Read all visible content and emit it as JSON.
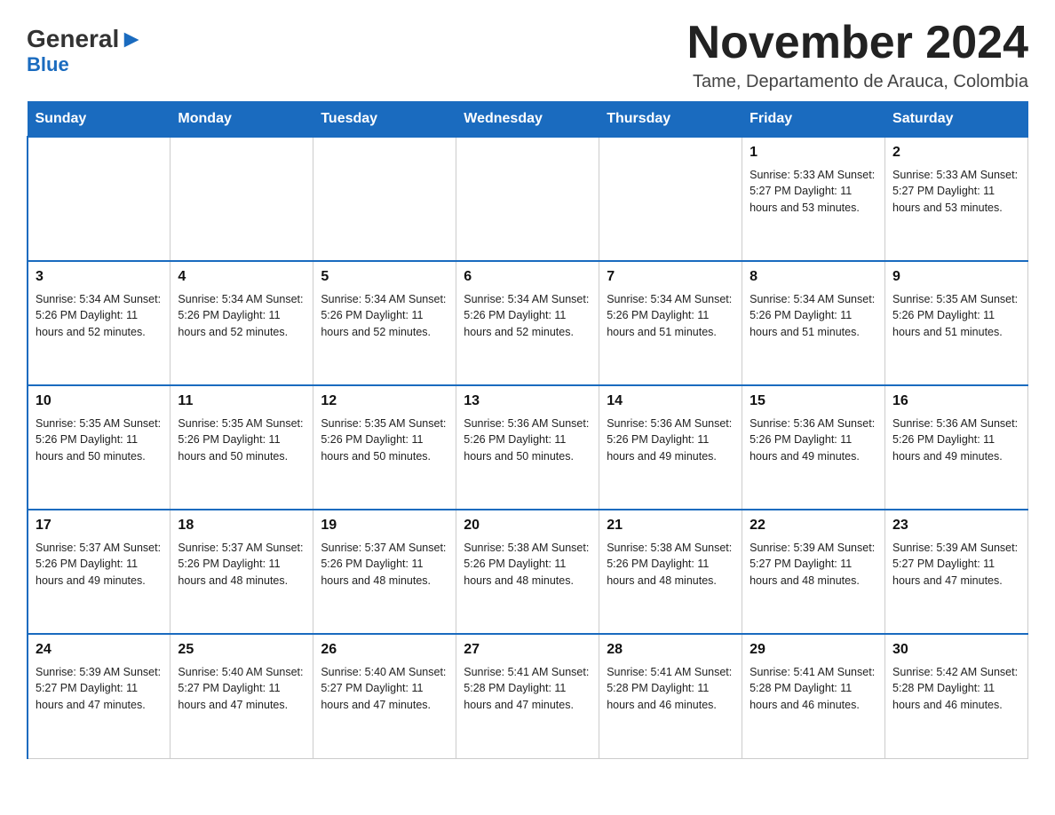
{
  "header": {
    "logo": {
      "general": "General",
      "blue": "Blue",
      "arrow": "▶"
    },
    "title": "November 2024",
    "subtitle": "Tame, Departamento de Arauca, Colombia"
  },
  "days_of_week": [
    "Sunday",
    "Monday",
    "Tuesday",
    "Wednesday",
    "Thursday",
    "Friday",
    "Saturday"
  ],
  "weeks": [
    [
      {
        "day": "",
        "info": ""
      },
      {
        "day": "",
        "info": ""
      },
      {
        "day": "",
        "info": ""
      },
      {
        "day": "",
        "info": ""
      },
      {
        "day": "",
        "info": ""
      },
      {
        "day": "1",
        "info": "Sunrise: 5:33 AM\nSunset: 5:27 PM\nDaylight: 11 hours and 53 minutes."
      },
      {
        "day": "2",
        "info": "Sunrise: 5:33 AM\nSunset: 5:27 PM\nDaylight: 11 hours and 53 minutes."
      }
    ],
    [
      {
        "day": "3",
        "info": "Sunrise: 5:34 AM\nSunset: 5:26 PM\nDaylight: 11 hours and 52 minutes."
      },
      {
        "day": "4",
        "info": "Sunrise: 5:34 AM\nSunset: 5:26 PM\nDaylight: 11 hours and 52 minutes."
      },
      {
        "day": "5",
        "info": "Sunrise: 5:34 AM\nSunset: 5:26 PM\nDaylight: 11 hours and 52 minutes."
      },
      {
        "day": "6",
        "info": "Sunrise: 5:34 AM\nSunset: 5:26 PM\nDaylight: 11 hours and 52 minutes."
      },
      {
        "day": "7",
        "info": "Sunrise: 5:34 AM\nSunset: 5:26 PM\nDaylight: 11 hours and 51 minutes."
      },
      {
        "day": "8",
        "info": "Sunrise: 5:34 AM\nSunset: 5:26 PM\nDaylight: 11 hours and 51 minutes."
      },
      {
        "day": "9",
        "info": "Sunrise: 5:35 AM\nSunset: 5:26 PM\nDaylight: 11 hours and 51 minutes."
      }
    ],
    [
      {
        "day": "10",
        "info": "Sunrise: 5:35 AM\nSunset: 5:26 PM\nDaylight: 11 hours and 50 minutes."
      },
      {
        "day": "11",
        "info": "Sunrise: 5:35 AM\nSunset: 5:26 PM\nDaylight: 11 hours and 50 minutes."
      },
      {
        "day": "12",
        "info": "Sunrise: 5:35 AM\nSunset: 5:26 PM\nDaylight: 11 hours and 50 minutes."
      },
      {
        "day": "13",
        "info": "Sunrise: 5:36 AM\nSunset: 5:26 PM\nDaylight: 11 hours and 50 minutes."
      },
      {
        "day": "14",
        "info": "Sunrise: 5:36 AM\nSunset: 5:26 PM\nDaylight: 11 hours and 49 minutes."
      },
      {
        "day": "15",
        "info": "Sunrise: 5:36 AM\nSunset: 5:26 PM\nDaylight: 11 hours and 49 minutes."
      },
      {
        "day": "16",
        "info": "Sunrise: 5:36 AM\nSunset: 5:26 PM\nDaylight: 11 hours and 49 minutes."
      }
    ],
    [
      {
        "day": "17",
        "info": "Sunrise: 5:37 AM\nSunset: 5:26 PM\nDaylight: 11 hours and 49 minutes."
      },
      {
        "day": "18",
        "info": "Sunrise: 5:37 AM\nSunset: 5:26 PM\nDaylight: 11 hours and 48 minutes."
      },
      {
        "day": "19",
        "info": "Sunrise: 5:37 AM\nSunset: 5:26 PM\nDaylight: 11 hours and 48 minutes."
      },
      {
        "day": "20",
        "info": "Sunrise: 5:38 AM\nSunset: 5:26 PM\nDaylight: 11 hours and 48 minutes."
      },
      {
        "day": "21",
        "info": "Sunrise: 5:38 AM\nSunset: 5:26 PM\nDaylight: 11 hours and 48 minutes."
      },
      {
        "day": "22",
        "info": "Sunrise: 5:39 AM\nSunset: 5:27 PM\nDaylight: 11 hours and 48 minutes."
      },
      {
        "day": "23",
        "info": "Sunrise: 5:39 AM\nSunset: 5:27 PM\nDaylight: 11 hours and 47 minutes."
      }
    ],
    [
      {
        "day": "24",
        "info": "Sunrise: 5:39 AM\nSunset: 5:27 PM\nDaylight: 11 hours and 47 minutes."
      },
      {
        "day": "25",
        "info": "Sunrise: 5:40 AM\nSunset: 5:27 PM\nDaylight: 11 hours and 47 minutes."
      },
      {
        "day": "26",
        "info": "Sunrise: 5:40 AM\nSunset: 5:27 PM\nDaylight: 11 hours and 47 minutes."
      },
      {
        "day": "27",
        "info": "Sunrise: 5:41 AM\nSunset: 5:28 PM\nDaylight: 11 hours and 47 minutes."
      },
      {
        "day": "28",
        "info": "Sunrise: 5:41 AM\nSunset: 5:28 PM\nDaylight: 11 hours and 46 minutes."
      },
      {
        "day": "29",
        "info": "Sunrise: 5:41 AM\nSunset: 5:28 PM\nDaylight: 11 hours and 46 minutes."
      },
      {
        "day": "30",
        "info": "Sunrise: 5:42 AM\nSunset: 5:28 PM\nDaylight: 11 hours and 46 minutes."
      }
    ]
  ]
}
